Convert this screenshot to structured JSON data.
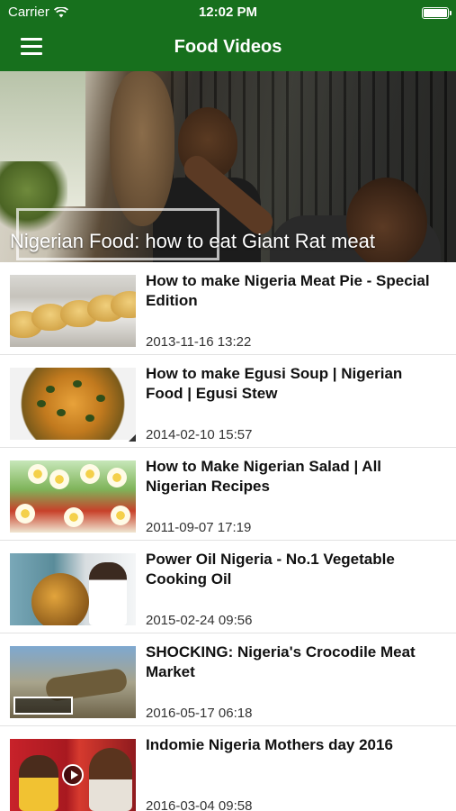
{
  "status_bar": {
    "carrier": "Carrier",
    "time": "12:02 PM"
  },
  "nav": {
    "title": "Food Videos"
  },
  "featured": {
    "title": "Nigerian Food: how to eat Giant Rat meat"
  },
  "videos": [
    {
      "title": "How to make Nigeria Meat Pie - Special Edition",
      "date": "2013-11-16 13:22"
    },
    {
      "title": "How to make Egusi Soup | Nigerian Food | Egusi Stew",
      "date": "2014-02-10 15:57"
    },
    {
      "title": "How to Make Nigerian Salad | All Nigerian Recipes",
      "date": "2011-09-07 17:19"
    },
    {
      "title": "Power Oil Nigeria - No.1 Vegetable Cooking Oil",
      "date": "2015-02-24 09:56"
    },
    {
      "title": "SHOCKING: Nigeria's Crocodile Meat Market",
      "date": "2016-05-17 06:18"
    },
    {
      "title": "Indomie Nigeria Mothers day 2016",
      "date": "2016-03-04 09:58"
    }
  ],
  "colors": {
    "nav_bar": "#17701d",
    "text": "#111111"
  }
}
